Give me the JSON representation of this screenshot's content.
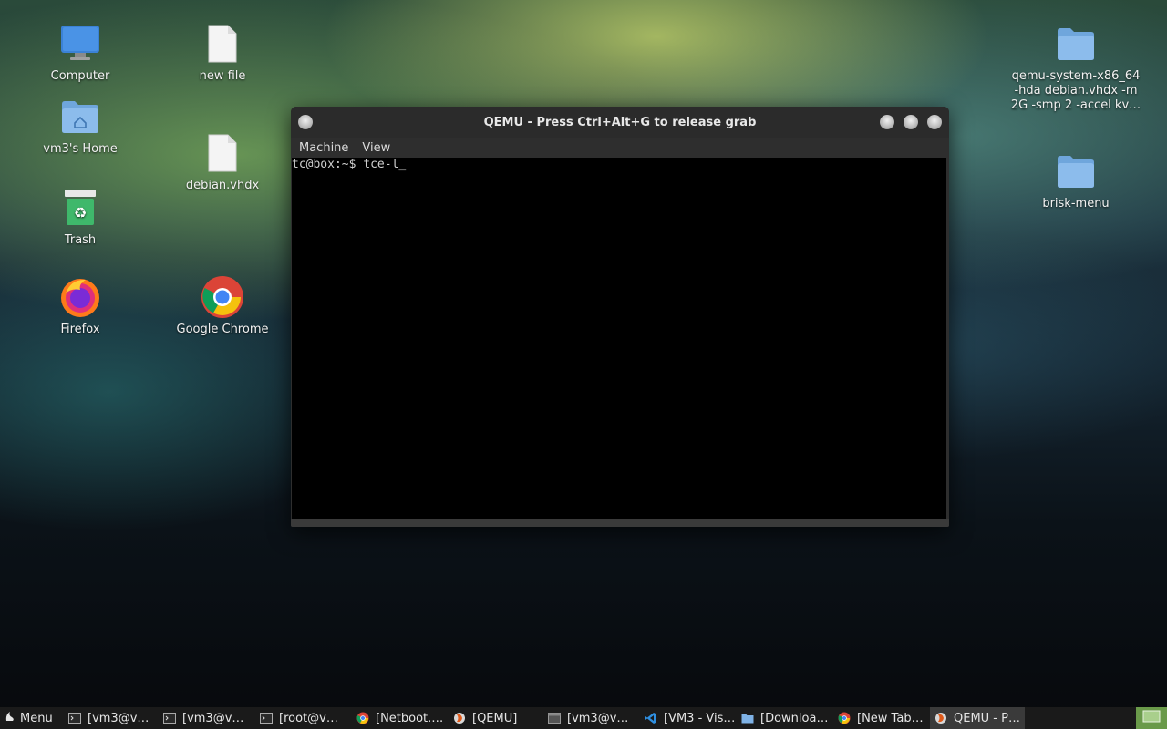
{
  "desktop": {
    "icons": [
      {
        "label": "Computer"
      },
      {
        "label": "new file"
      },
      {
        "label": "vm3's Home"
      },
      {
        "label": "debian.vhdx"
      },
      {
        "label": "Trash"
      },
      {
        "label": "Firefox"
      },
      {
        "label": "Google Chrome"
      },
      {
        "label": "qemu-system-x86_64\n-hda debian.vhdx -m\n2G -smp 2 -accel kv…"
      },
      {
        "label": "brisk-menu"
      }
    ]
  },
  "qemu_window": {
    "title": "QEMU - Press Ctrl+Alt+G to release grab",
    "menu": [
      "Machine",
      "View"
    ],
    "terminal_lines": [
      "tc@box:~$ tce-l_"
    ]
  },
  "taskbar": {
    "menu_label": "Menu",
    "tasks": [
      {
        "label": "[vm3@v…",
        "icon": "terminal-icon"
      },
      {
        "label": "[vm3@v…",
        "icon": "terminal-icon"
      },
      {
        "label": "[root@v…",
        "icon": "terminal-icon"
      },
      {
        "label": "[Netboot.…",
        "icon": "chrome-icon"
      },
      {
        "label": "[QEMU]",
        "icon": "qemu-icon"
      },
      {
        "label": "[vm3@v…",
        "icon": "window-icon"
      },
      {
        "label": "[VM3 - Vis…",
        "icon": "vscode-icon"
      },
      {
        "label": "[Downloa…",
        "icon": "folder-icon"
      },
      {
        "label": "[New Tab…",
        "icon": "chrome-icon"
      },
      {
        "label": "QEMU - P…",
        "icon": "qemu-icon"
      }
    ]
  },
  "colors": {
    "folder": "#7fb2e6",
    "taskbar_bg": "#1a1a1a",
    "show_desktop": "#6a9a4a"
  }
}
